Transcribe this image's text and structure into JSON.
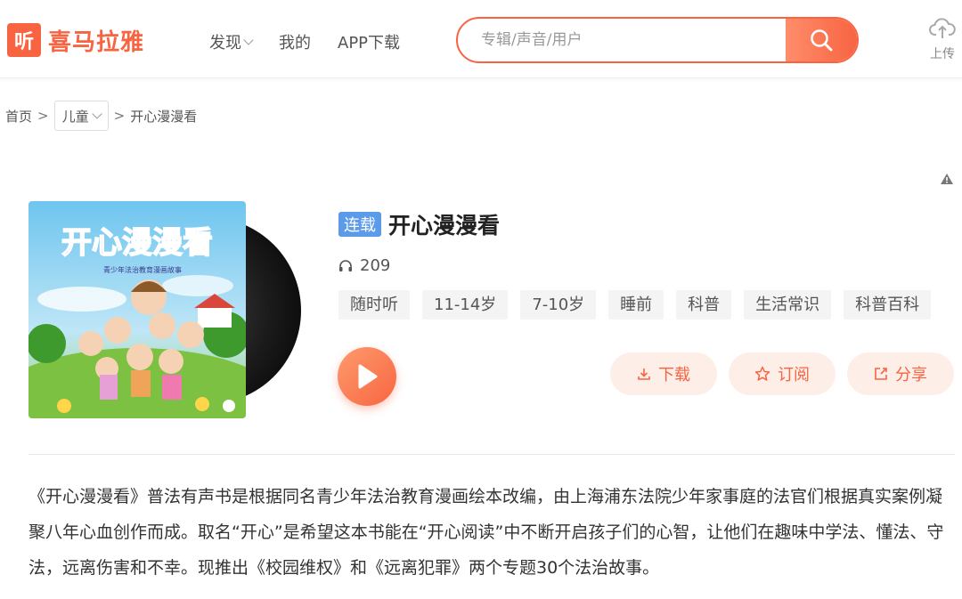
{
  "header": {
    "logo_mark": "听",
    "logo_text": "喜马拉雅",
    "nav": [
      {
        "label": "发现",
        "has_dropdown": true
      },
      {
        "label": "我的",
        "has_dropdown": false
      },
      {
        "label": "APP下载",
        "has_dropdown": false
      }
    ],
    "search": {
      "placeholder": "专辑/声音/用户",
      "value": ""
    },
    "upload_label": "上传"
  },
  "breadcrumb": {
    "home": "首页",
    "category": "儿童",
    "current": "开心漫漫看",
    "separator": ">"
  },
  "album": {
    "serial_tag": "连载",
    "title": "开心漫漫看",
    "play_count": "209",
    "cover_title": "开心漫漫看",
    "cover_subtitle": "青少年法治教育漫画故事",
    "tags": [
      "随时听",
      "11-14岁",
      "7-10岁",
      "睡前",
      "科普",
      "生活常识",
      "科普百科"
    ],
    "actions": {
      "download": "下载",
      "subscribe": "订阅",
      "share": "分享"
    },
    "intro": "《开心漫漫看》普法有声书是根据同名青少年法治教育漫画绘本改编，由上海浦东法院少年家事庭的法官们根据真实案例凝聚八年心血创作而成。取名“开心”是希望这本书能在“开心阅读”中不断开启孩子们的心智，让他们在趣味中学法、懂法、守法，远离伤害和不幸。现推出《校园维权》和《远离犯罪》两个专题30个法治故事。"
  },
  "colors": {
    "brand": "#f86442",
    "serial_tag": "#5b9bea",
    "action_bg": "#fdeee8"
  }
}
